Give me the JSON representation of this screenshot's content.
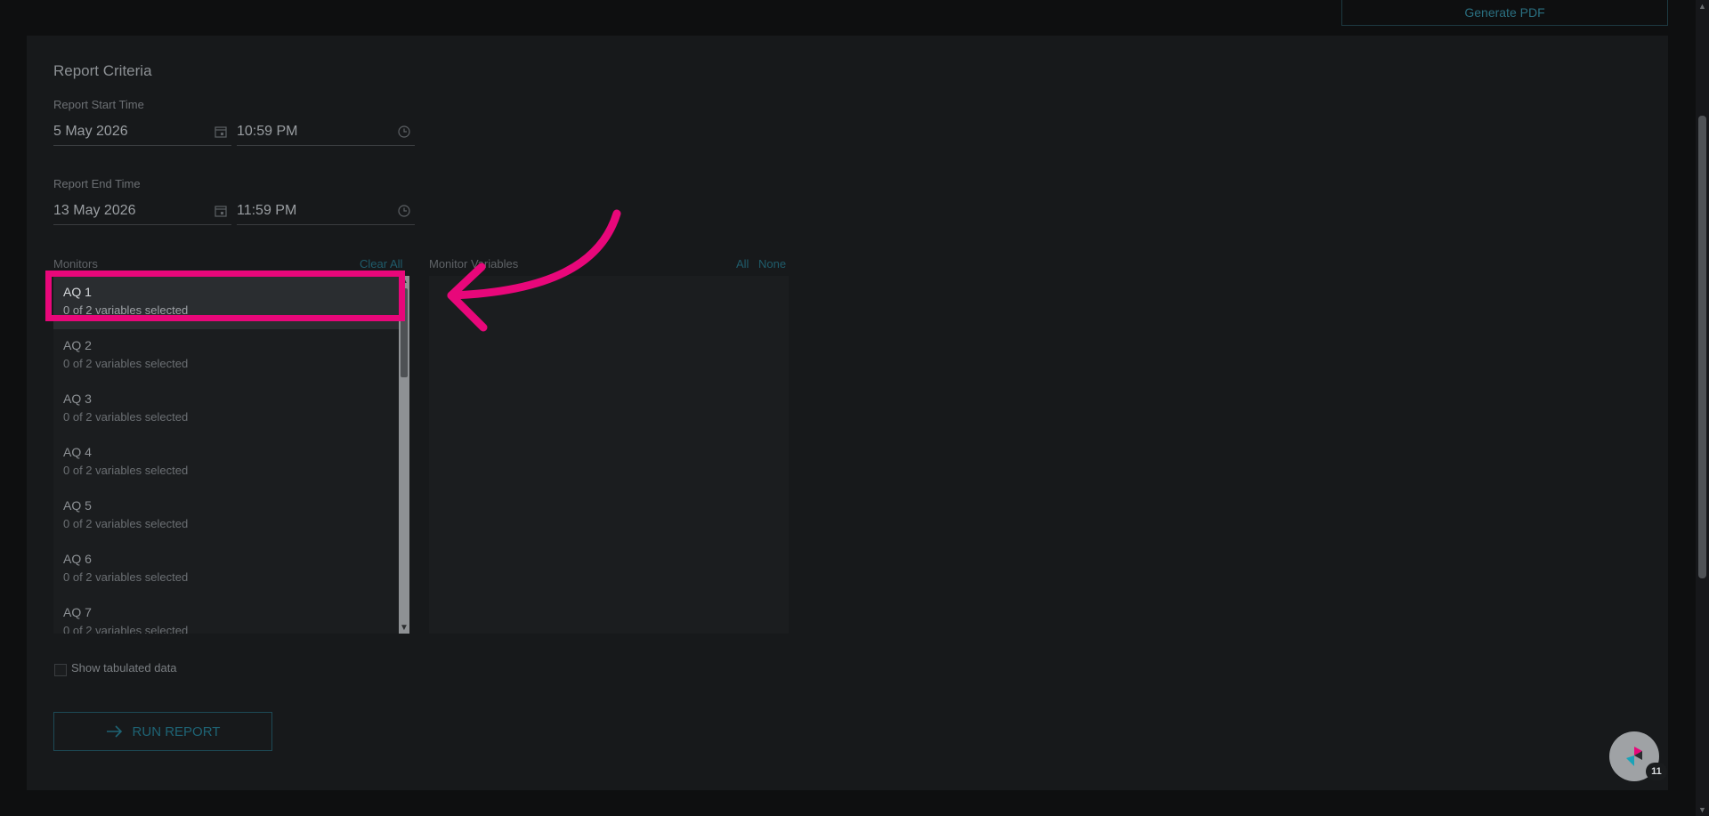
{
  "toolbar": {
    "generate_pdf_label": "Generate PDF"
  },
  "report_criteria": {
    "title": "Report Criteria",
    "start": {
      "label": "Report Start Time",
      "date": "5 May 2026",
      "time": "10:59 PM"
    },
    "end": {
      "label": "Report End Time",
      "date": "13 May 2026",
      "time": "11:59 PM"
    }
  },
  "monitors": {
    "label": "Monitors",
    "clear_all_label": "Clear All",
    "items": [
      {
        "name": "AQ 1",
        "sub": "0 of 2 variables selected",
        "selected": true
      },
      {
        "name": "AQ 2",
        "sub": "0 of 2 variables selected"
      },
      {
        "name": "AQ 3",
        "sub": "0 of 2 variables selected"
      },
      {
        "name": "AQ 4",
        "sub": "0 of 2 variables selected"
      },
      {
        "name": "AQ 5",
        "sub": "0 of 2 variables selected"
      },
      {
        "name": "AQ 6",
        "sub": "0 of 2 variables selected"
      },
      {
        "name": "AQ 7",
        "sub": "0 of 2 variables selected"
      }
    ]
  },
  "monitor_variables": {
    "label": "Monitor Variables",
    "all_label": "All",
    "none_label": "None"
  },
  "options": {
    "show_tabulated_label": "Show tabulated data"
  },
  "run_report_label": "RUN REPORT",
  "chat": {
    "badge_count": "11"
  },
  "colors": {
    "highlight": "#e8077a",
    "accent": "#1e6374",
    "background": "#0e0f10"
  }
}
